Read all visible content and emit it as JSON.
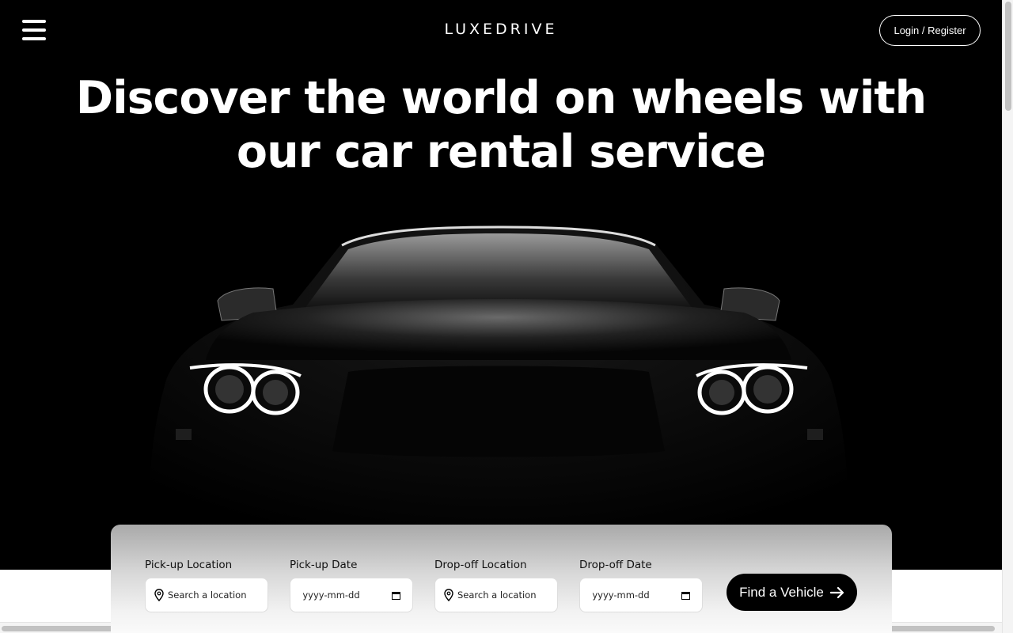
{
  "header": {
    "logo": "LUXEDRIVE",
    "login_label": "Login / Register"
  },
  "hero": {
    "headline_line1": "Discover the world on wheels with",
    "headline_line2": "our car rental service"
  },
  "search": {
    "pickup_location_label": "Pick-up Location",
    "pickup_location_placeholder": "Search a location",
    "pickup_date_label": "Pick-up Date",
    "pickup_date_placeholder": "yyyy-mm-dd",
    "dropoff_location_label": "Drop-off Location",
    "dropoff_location_placeholder": "Search a location",
    "dropoff_date_label": "Drop-off Date",
    "dropoff_date_placeholder": "yyyy-mm-dd",
    "find_label": "Find a Vehicle"
  },
  "icons": {
    "menu": "hamburger-menu-icon",
    "location": "map-pin-icon",
    "calendar": "calendar-icon",
    "arrow": "arrow-right-icon"
  },
  "colors": {
    "background": "#000000",
    "accent": "#ffffff"
  }
}
